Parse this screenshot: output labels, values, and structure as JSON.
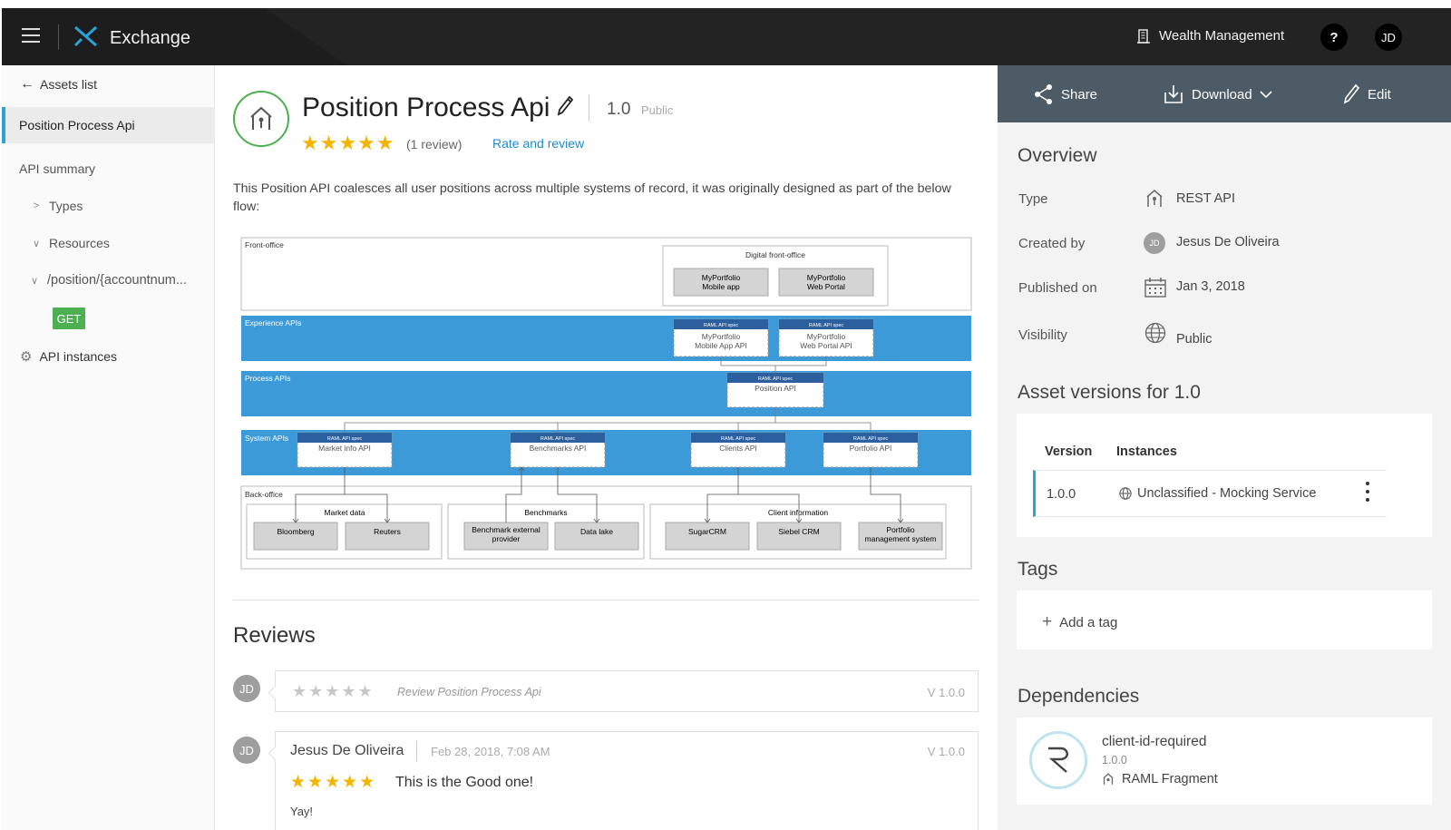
{
  "topbar": {
    "app_name": "Exchange",
    "org_name": "Wealth Management",
    "help_label": "?",
    "user_initials": "JD"
  },
  "leftnav": {
    "back_label": "Assets list",
    "active_item": "Position Process Api",
    "api_summary": "API summary",
    "types": "Types",
    "resources": "Resources",
    "resource_path": "/position/{accountnum...",
    "method_badge": "GET",
    "api_instances": "API instances"
  },
  "asset": {
    "title": "Position Process Api",
    "version": "1.0",
    "visibility": "Public",
    "stars": "★★★★★",
    "review_count": "(1 review)",
    "rate_link": "Rate and review",
    "description": "This Position API coalesces all user positions across multiple systems of record, it was originally designed as part of the below flow:"
  },
  "diagram": {
    "lanes": {
      "front": "Front-office",
      "experience": "Experience APIs",
      "process": "Process APIs",
      "system": "System APIs",
      "back": "Back-office"
    },
    "digital_front_office": "Digital front-office",
    "mobile_app_line1": "MyPortfolio",
    "mobile_app_line2": "Mobile app",
    "web_portal_line1": "MyPortfolio",
    "web_portal_line2": "Web Portal",
    "spec_tag": "RAML API spec",
    "mobile_api_line1": "MyPortfolio",
    "mobile_api_line2": "Mobile App API",
    "web_api_line1": "MyPortfolio",
    "web_api_line2": "Web Portal API",
    "position_api": "Position API",
    "market_info_api": "Market info API",
    "benchmarks_api": "Benchmarks API",
    "clients_api": "Clients API",
    "portfolio_api": "Portfolio API",
    "market_data": "Market data",
    "benchmarks": "Benchmarks",
    "client_information": "Client information",
    "bloomberg": "Bloomberg",
    "reuters": "Reuters",
    "benchmark_provider_line1": "Benchmark external",
    "benchmark_provider_line2": "provider",
    "data_lake": "Data lake",
    "sugarcrm": "SugarCRM",
    "siebel": "Siebel CRM",
    "portfolio_mgmt_line1": "Portfolio",
    "portfolio_mgmt_line2": "management system"
  },
  "reviews": {
    "heading": "Reviews",
    "new_review": {
      "avatar": "JD",
      "stars": "★★★★★",
      "placeholder": "Review Position Process Api",
      "version": "V 1.0.0"
    },
    "items": [
      {
        "avatar": "JD",
        "author": "Jesus De Oliveira",
        "date": "Feb 28, 2018, 7:08 AM",
        "version": "V 1.0.0",
        "stars": "★★★★★",
        "headline": "This is the Good one!",
        "body": "Yay!"
      }
    ]
  },
  "toolbar": {
    "share": "Share",
    "download": "Download",
    "edit": "Edit"
  },
  "overview": {
    "heading": "Overview",
    "type_label": "Type",
    "type_value": "REST API",
    "created_label": "Created by",
    "created_avatar": "JD",
    "created_value": "Jesus De Oliveira",
    "published_label": "Published on",
    "published_value": "Jan 3, 2018",
    "visibility_label": "Visibility",
    "visibility_value": "Public"
  },
  "versions": {
    "heading": "Asset versions for 1.0",
    "col_version": "Version",
    "col_instances": "Instances",
    "rows": [
      {
        "version": "1.0.0",
        "instance": "Unclassified - Mocking Service"
      }
    ]
  },
  "tags": {
    "heading": "Tags",
    "add_label": "Add a tag"
  },
  "dependencies": {
    "heading": "Dependencies",
    "items": [
      {
        "name": "client-id-required",
        "version": "1.0.0",
        "type": "RAML Fragment"
      }
    ]
  },
  "colors": {
    "accent_blue": "#29a3d8",
    "star_gold": "#f5b400",
    "rest_green": "#4caf50",
    "topbar": "#232323",
    "toolbar": "#4d5b66",
    "lane_blue": "#3d9ad9"
  }
}
